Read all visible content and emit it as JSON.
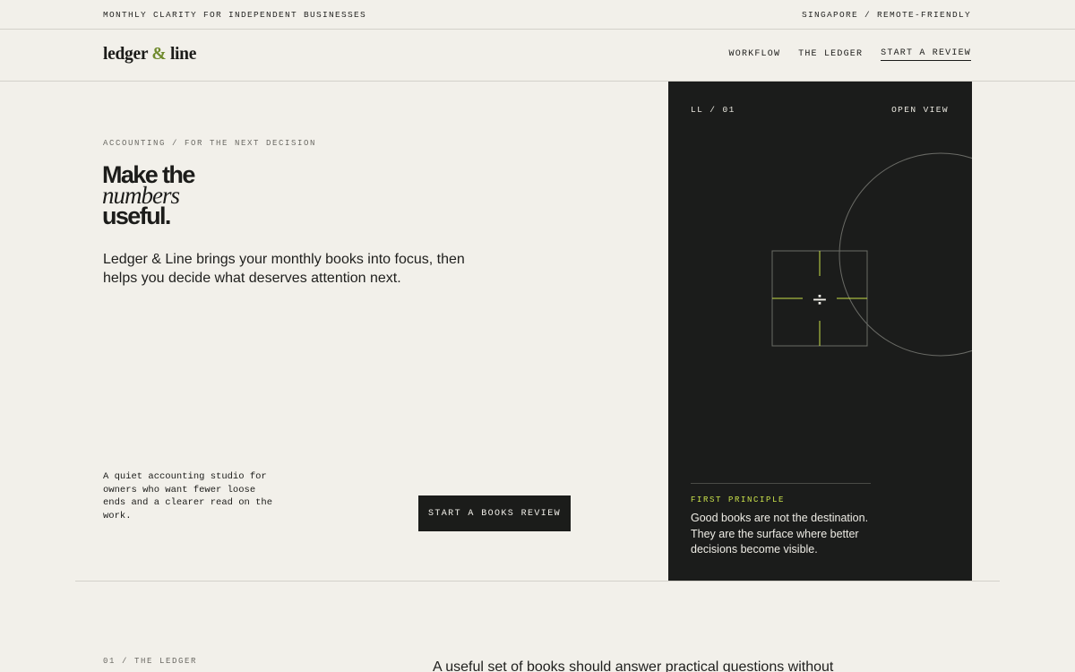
{
  "topbar": {
    "tagline": "MONTHLY CLARITY FOR INDEPENDENT BUSINESSES",
    "location": "SINGAPORE / REMOTE-FRIENDLY"
  },
  "header": {
    "logo_left": "ledger",
    "logo_amp": "&",
    "logo_right": "line",
    "nav": [
      {
        "label": "WORKFLOW"
      },
      {
        "label": "THE LEDGER"
      },
      {
        "label": "START A REVIEW"
      }
    ]
  },
  "hero": {
    "eyebrow": "ACCOUNTING / FOR THE NEXT DECISION",
    "headline_line1": "Make the",
    "headline_line2": "numbers",
    "headline_line3": "useful.",
    "lede": "Ledger & Line brings your monthly books into focus, then helps you decide what deserves attention next.",
    "blurb": "A quiet accounting studio for owners who want fewer loose ends and a clearer read on the work.",
    "cta_label": "START A BOOKS REVIEW"
  },
  "panel": {
    "code": "LL / 01",
    "open_label": "OPEN VIEW",
    "symbol": "÷",
    "principle_label": "FIRST PRINCIPLE",
    "principle_text": "Good books are not the destination. They are the surface where better decisions become visible.",
    "colors": {
      "background": "#1b1c1b",
      "accent": "#c8e04a"
    }
  },
  "section": {
    "label": "01 / THE LEDGER",
    "lead": "A useful set of books should answer practical questions without"
  },
  "colors": {
    "page_bg": "#f2f0ea",
    "ink": "#1c1c1a",
    "brand_accent": "#6f8a2c"
  }
}
